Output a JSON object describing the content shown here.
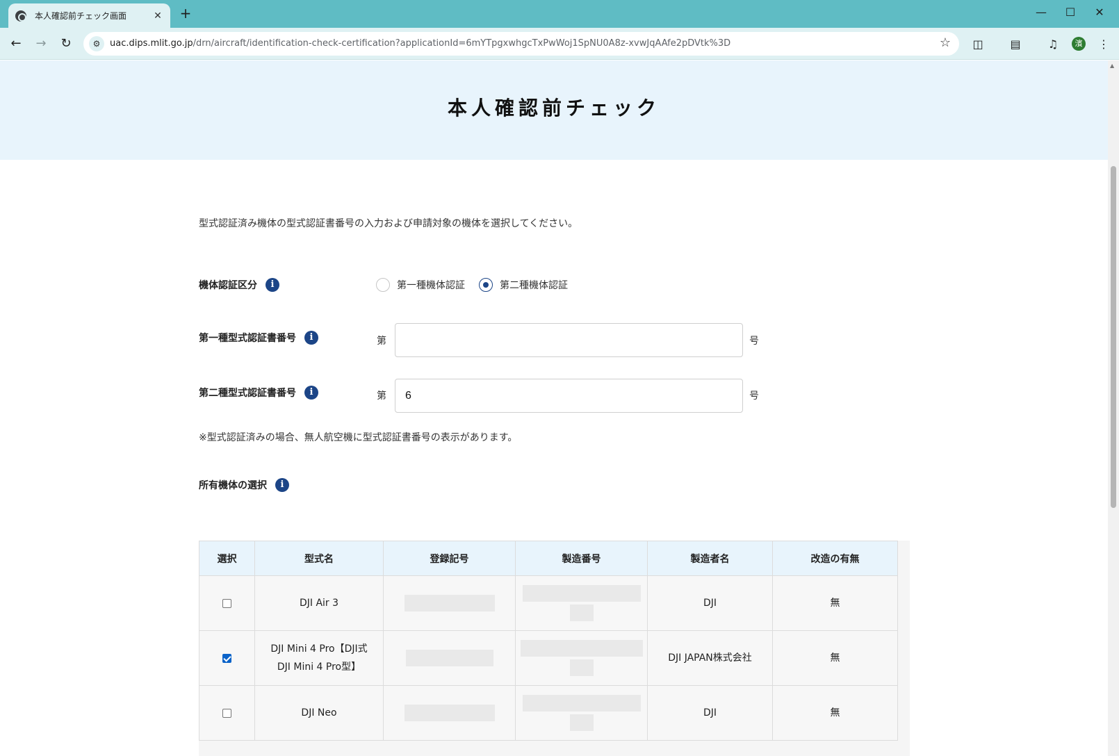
{
  "browser": {
    "tab_title": "本人確認前チェック画面",
    "tab_close": "✕",
    "new_tab": "+",
    "url_host": "uac.dips.mlit.go.jp",
    "url_path": "/drn/aircraft/identification-check-certification?applicationId=6mYTpgxwhgcTxPwWoj1SpNU0A8z-xvwJqAAfe2pDVtk%3D",
    "profile_initial": "濱"
  },
  "page": {
    "title": "本人確認前チェック",
    "intro": "型式認証済み機体の型式認証書番号の入力および申請対象の機体を選択してください。",
    "note": "※型式認証済みの場合、無人航空機に型式認証書番号の表示があります。"
  },
  "form": {
    "category": {
      "label": "機体認証区分",
      "options": [
        {
          "label": "第一種機体認証",
          "selected": false
        },
        {
          "label": "第二種機体認証",
          "selected": true
        }
      ]
    },
    "type1_cert": {
      "label": "第一種型式認証書番号",
      "prefix": "第",
      "suffix": "号",
      "value": ""
    },
    "type2_cert": {
      "label": "第二種型式認証書番号",
      "prefix": "第",
      "suffix": "号",
      "value": "6"
    }
  },
  "owned": {
    "label": "所有機体の選択",
    "columns": [
      "選択",
      "型式名",
      "登録記号",
      "製造番号",
      "製造者名",
      "改造の有無"
    ],
    "rows": [
      {
        "checked": false,
        "model": "DJI Air 3",
        "maker": "DJI",
        "modified": "無"
      },
      {
        "checked": true,
        "model_line1": "DJI Mini 4 Pro【DJI式",
        "model_line2": "DJI Mini 4 Pro型】",
        "maker": "DJI JAPAN株式会社",
        "modified": "無"
      },
      {
        "checked": false,
        "model": "DJI Neo",
        "maker": "DJI",
        "modified": "無"
      }
    ]
  },
  "info_glyph": "i"
}
